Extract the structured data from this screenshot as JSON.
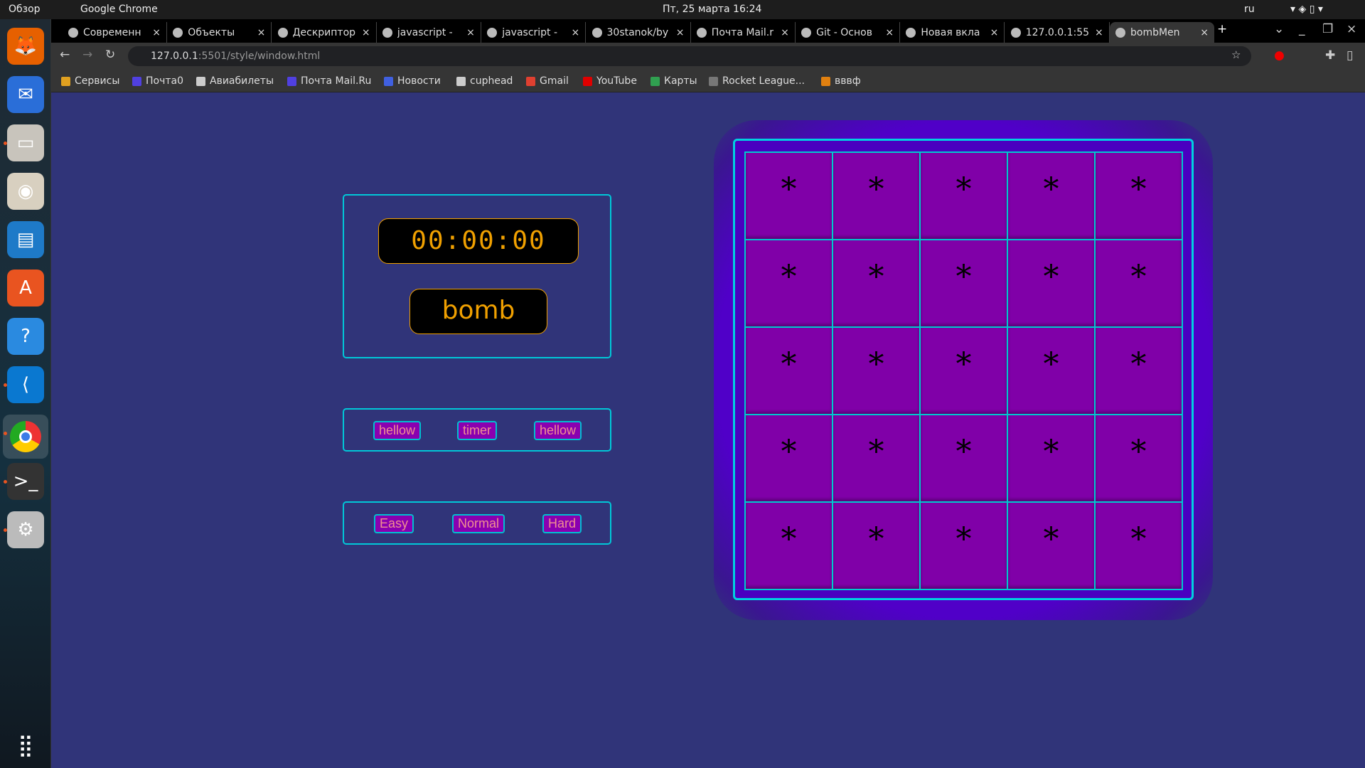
{
  "system": {
    "activities": "Обзор",
    "app": "Google Chrome",
    "datetime": "Пт, 25 марта  16:24",
    "lang": "ru"
  },
  "dock": [
    "firefox-icon",
    "thunderbird-icon",
    "files-icon",
    "rhythmbox-icon",
    "writer-icon",
    "software-icon",
    "help-icon",
    "vscode-icon",
    "chrome-icon",
    "terminal-icon",
    "settings-icon"
  ],
  "tabs": [
    {
      "label": "Современн"
    },
    {
      "label": "Объекты"
    },
    {
      "label": "Дескриптор"
    },
    {
      "label": "javascript - "
    },
    {
      "label": "javascript - "
    },
    {
      "label": "30stanok/by"
    },
    {
      "label": "Почта Mail.r"
    },
    {
      "label": "Git - Основ"
    },
    {
      "label": "Новая вкла"
    },
    {
      "label": "127.0.0.1:55"
    },
    {
      "label": "bombMen",
      "active": true
    }
  ],
  "address": {
    "host": "127.0.0.1",
    "rest": ":5501/style/window.html"
  },
  "bookmarks": [
    {
      "label": "Сервисы",
      "color": "#e0a020"
    },
    {
      "label": "Почта0",
      "color": "#5040e0"
    },
    {
      "label": "Авиабилеты",
      "color": "#ccc"
    },
    {
      "label": "Почта Mail.Ru",
      "color": "#5040e0"
    },
    {
      "label": "Новости",
      "color": "#4060e0"
    },
    {
      "label": "cuphead",
      "color": "#ccc"
    },
    {
      "label": "Gmail",
      "color": "#e04030"
    },
    {
      "label": "YouTube",
      "color": "#e00000"
    },
    {
      "label": "Карты",
      "color": "#30a050"
    },
    {
      "label": "Rocket League...",
      "color": "#777"
    },
    {
      "label": "вввф",
      "color": "#e08010"
    }
  ],
  "game": {
    "timer": "00:00:00",
    "bomb": "bomb",
    "row1": [
      "hellow",
      "timer",
      "hellow"
    ],
    "difficulty": [
      "Easy",
      "Normal",
      "Hard"
    ],
    "cell_symbol": "*",
    "rows": 5,
    "cols": 5
  },
  "colors": {
    "background": "#303479",
    "accent": "#00c8d8",
    "cell": "#8000a8",
    "timer_text": "#f0a000"
  }
}
